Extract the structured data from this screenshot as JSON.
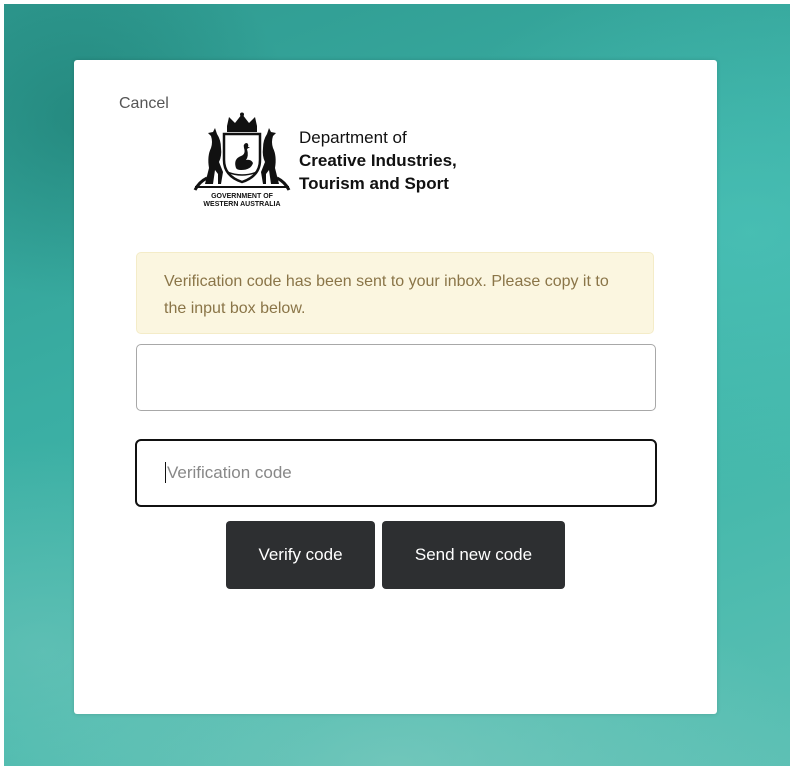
{
  "cancel_label": "Cancel",
  "logo": {
    "department_line1": "Department of",
    "department_line2": "Creative Industries,",
    "department_line3": "Tourism and Sport",
    "government_line1": "GOVERNMENT OF",
    "government_line2": "WESTERN AUSTRALIA"
  },
  "alert": {
    "message": "Verification code has been sent to your inbox. Please copy it to the input box below."
  },
  "email_field": {
    "value": ""
  },
  "code_field": {
    "placeholder": "Verification code",
    "value": ""
  },
  "buttons": {
    "verify_label": "Verify code",
    "send_new_label": "Send new code"
  },
  "colors": {
    "button_bg": "#2d2f31",
    "alert_bg": "#fbf6e0",
    "alert_text": "#8a7548",
    "background_teal": "#3aaea3"
  }
}
